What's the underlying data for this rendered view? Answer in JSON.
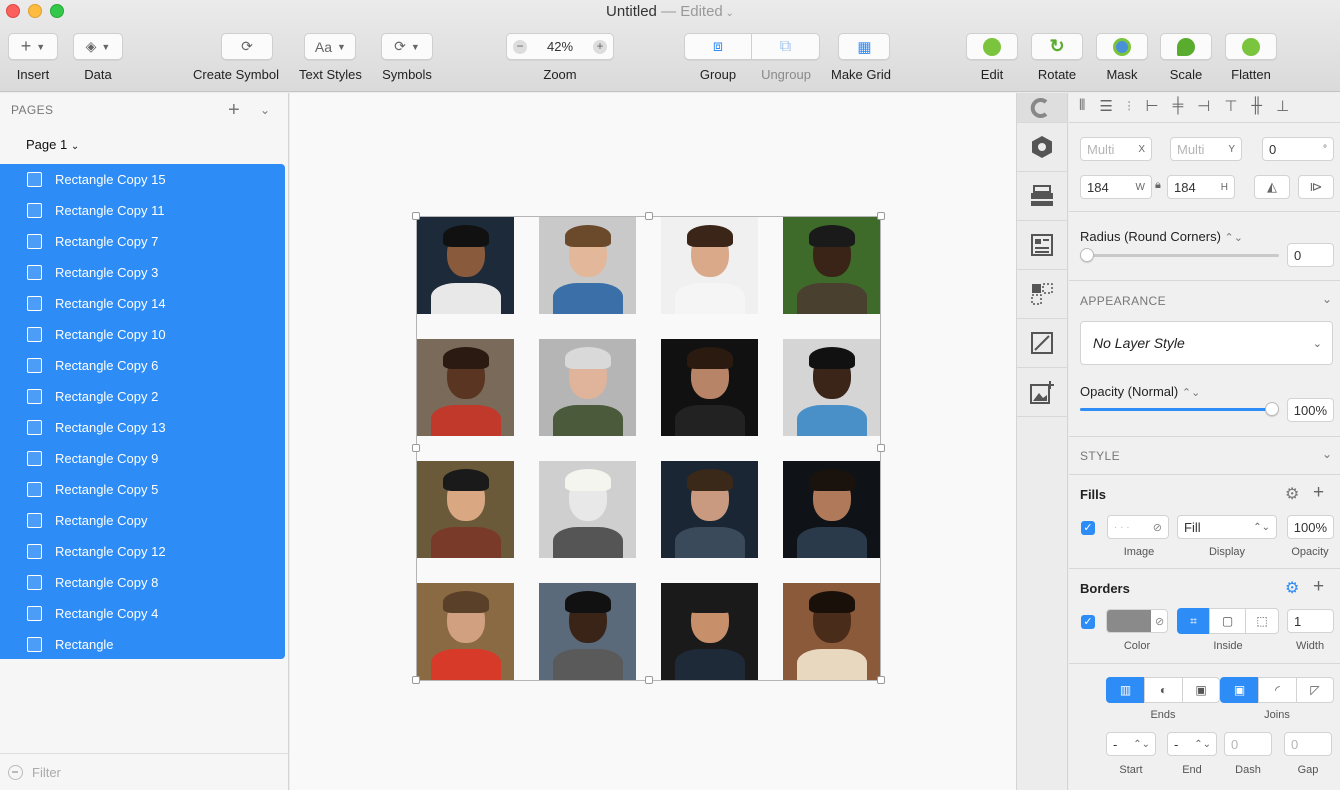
{
  "window": {
    "title": "Untitled",
    "separator": "—",
    "edited": "Edited"
  },
  "toolbar": {
    "insert": "Insert",
    "data": "Data",
    "create_symbol": "Create Symbol",
    "text_styles": "Text Styles",
    "text_styles_glyph": "Aa",
    "symbols": "Symbols",
    "zoom": "Zoom",
    "zoom_value": "42%",
    "group": "Group",
    "ungroup": "Ungroup",
    "make_grid": "Make Grid",
    "edit": "Edit",
    "rotate": "Rotate",
    "mask": "Mask",
    "scale": "Scale",
    "flatten": "Flatten"
  },
  "sidebar": {
    "pages_header": "PAGES",
    "current_page": "Page 1",
    "layers": [
      "Rectangle Copy 15",
      "Rectangle Copy 11",
      "Rectangle Copy 7",
      "Rectangle Copy 3",
      "Rectangle Copy 14",
      "Rectangle Copy 10",
      "Rectangle Copy 6",
      "Rectangle Copy 2",
      "Rectangle Copy 13",
      "Rectangle Copy 9",
      "Rectangle Copy 5",
      "Rectangle Copy",
      "Rectangle Copy 12",
      "Rectangle Copy 8",
      "Rectangle Copy 4",
      "Rectangle"
    ],
    "filter_placeholder": "Filter"
  },
  "inspector": {
    "x_value": "Multi",
    "x_suffix": "X",
    "y_value": "Multi",
    "y_suffix": "Y",
    "rotation": "0",
    "rotation_suffix": "°",
    "width": "184",
    "width_suffix": "W",
    "height": "184",
    "height_suffix": "H",
    "radius_label": "Radius (Round Corners)",
    "radius_value": "0",
    "appearance_header": "APPEARANCE",
    "layer_style": "No Layer Style",
    "opacity_label": "Opacity (Normal)",
    "opacity_value": "100%",
    "opacity_fraction": 1.0,
    "style_header": "STYLE",
    "fills_label": "Fills",
    "fill_display": "Fill",
    "fill_opacity": "100%",
    "fill_image_label": "Image",
    "fill_display_label": "Display",
    "fill_opacity_label": "Opacity",
    "borders_label": "Borders",
    "border_width": "1",
    "border_color_label": "Color",
    "border_position_label": "Inside",
    "border_width_label": "Width",
    "ends_label": "Ends",
    "joins_label": "Joins",
    "start_value": "-",
    "end_value": "-",
    "dash_placeholder": "0",
    "gap_placeholder": "0",
    "start_label": "Start",
    "end_label": "End",
    "dash_label": "Dash",
    "gap_label": "Gap"
  },
  "colors": {
    "accent": "#2d8cf6",
    "border_color": "#8a8a8a"
  },
  "canvas": {
    "photos": [
      {
        "bg": "#1d2a3a",
        "skin": "#8a5a3c",
        "hair": "#111",
        "shirt": "#e8e8e8"
      },
      {
        "bg": "#c9c9c9",
        "skin": "#e2b79a",
        "hair": "#6b4a2b",
        "shirt": "#3a6fa8"
      },
      {
        "bg": "#f0f0f0",
        "skin": "#d9a98a",
        "hair": "#3b2518",
        "shirt": "#f5f5f5"
      },
      {
        "bg": "#3f6b2a",
        "skin": "#3a2418",
        "hair": "#1a1a1a",
        "shirt": "#4a4030"
      },
      {
        "bg": "#7a6a5a",
        "skin": "#5a3522",
        "hair": "#2a1a12",
        "shirt": "#c0392b"
      },
      {
        "bg": "#b5b5b5",
        "skin": "#e0b49a",
        "hair": "#d9d9d9",
        "shirt": "#4a5a3a"
      },
      {
        "bg": "#111111",
        "skin": "#b88468",
        "hair": "#2a1a10",
        "shirt": "#222"
      },
      {
        "bg": "#d5d5d5",
        "skin": "#3b2418",
        "hair": "#111",
        "shirt": "#4a90c8"
      },
      {
        "bg": "#6b5a3a",
        "skin": "#d9a882",
        "hair": "#1a1a1a",
        "shirt": "#7a3a2a"
      },
      {
        "bg": "#cfcfcf",
        "skin": "#e8e8e8",
        "hair": "#f5f5f0",
        "shirt": "#555"
      },
      {
        "bg": "#1a2633",
        "skin": "#c99a80",
        "hair": "#3a2818",
        "shirt": "#3a4a5a"
      },
      {
        "bg": "#0f1216",
        "skin": "#b07a5a",
        "hair": "#1a120c",
        "shirt": "#2a3a4a"
      },
      {
        "bg": "#8a6a42",
        "skin": "#d0a080",
        "hair": "#5a4028",
        "shirt": "#d83a2a"
      },
      {
        "bg": "#5a6a7a",
        "skin": "#3a2418",
        "hair": "#111",
        "shirt": "#5a5a5a"
      },
      {
        "bg": "#1a1a1a",
        "skin": "#c8906a",
        "hair": "#1a1a1a",
        "shirt": "#1e2a38"
      },
      {
        "bg": "#8a5a3a",
        "skin": "#4a2c1a",
        "hair": "#1a100a",
        "shirt": "#e8d8c0"
      }
    ]
  }
}
